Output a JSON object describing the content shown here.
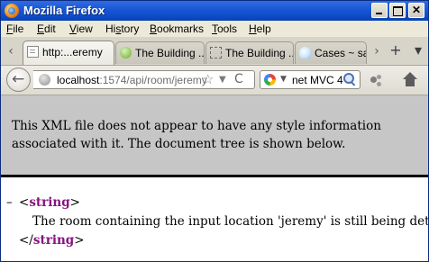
{
  "window": {
    "title": "Mozilla Firefox",
    "controls": {
      "minimize": "minimize-icon",
      "maximize": "maximize-icon",
      "close": "✕"
    }
  },
  "menu": {
    "items": [
      {
        "before": "",
        "mnemonic": "F",
        "after": "ile"
      },
      {
        "before": "",
        "mnemonic": "E",
        "after": "dit"
      },
      {
        "before": "",
        "mnemonic": "V",
        "after": "iew"
      },
      {
        "before": "Hi",
        "mnemonic": "s",
        "after": "tory"
      },
      {
        "before": "",
        "mnemonic": "B",
        "after": "ookmarks"
      },
      {
        "before": "",
        "mnemonic": "T",
        "after": "ools"
      },
      {
        "before": "",
        "mnemonic": "H",
        "after": "elp"
      }
    ]
  },
  "tabs": {
    "scroll_left": "‹",
    "items": [
      {
        "label": "http:...eremy",
        "icon": "page-icon",
        "active": true
      },
      {
        "label": "The Building ...",
        "icon": "chat-icon",
        "active": false
      },
      {
        "label": "The Building ...",
        "icon": "dotted-page-icon",
        "active": false
      },
      {
        "label": "Cases ~ sal",
        "icon": "cloud-icon",
        "active": false
      }
    ],
    "scroll_right": "›",
    "new_tab": "+",
    "list_all": "▾"
  },
  "nav": {
    "back": "←",
    "url_host": "localhost",
    "url_rest": ":1574/api/room/jeremy",
    "bookmark_star": "☆",
    "url_dropdown": "▼",
    "reload": "C",
    "search_text": "net MVC 4",
    "search_dropdown": "▼"
  },
  "content": {
    "notice": "This XML file does not appear to have any style information associated with it. The document tree is shown below.",
    "tree": {
      "collapse_toggle": "–",
      "open_bracket": "<",
      "tag": "string",
      "close_bracket": ">",
      "text": "The room containing the input location 'jeremy' is still being determined...",
      "end_open": "</",
      "end_tag": "string",
      "end_close": ">"
    }
  },
  "colors": {
    "titlebar": "#1b58d8",
    "chrome": "#ece9d8",
    "xml_notice_bg": "#c6c6c6",
    "tag_color": "#881280"
  }
}
